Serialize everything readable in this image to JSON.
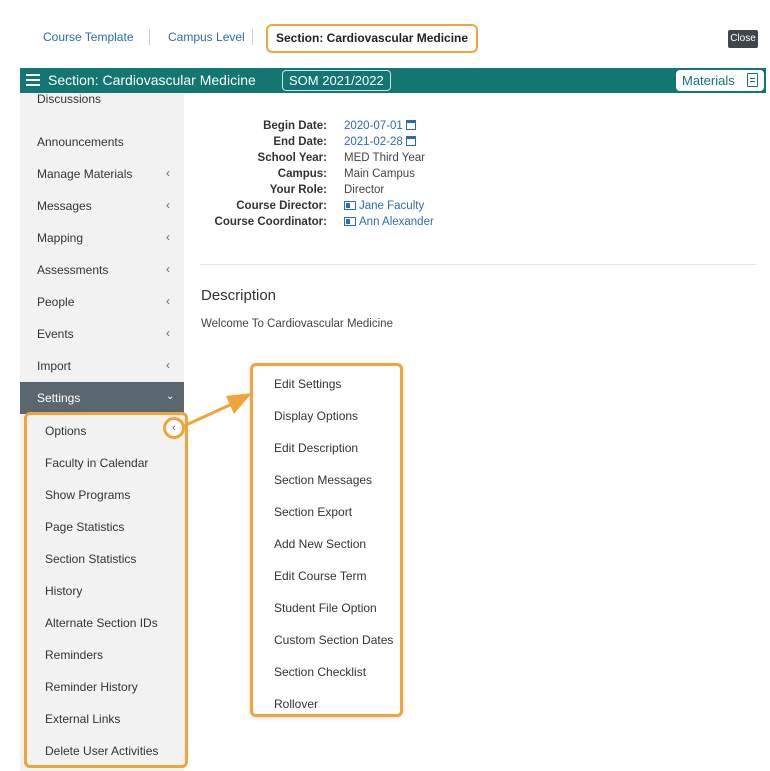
{
  "breadcrumbs": {
    "items": [
      "Course Template",
      "Campus Level"
    ],
    "active": "Section: Cardiovascular Medicine"
  },
  "close_label": "Close",
  "header": {
    "title": "Section: Cardiovascular Medicine",
    "year_badge": "SOM 2021/2022",
    "materials_label": "Materials"
  },
  "sidebar": {
    "items": [
      {
        "label": "Discussions",
        "has_submenu": false
      },
      {
        "label": "Announcements",
        "has_submenu": false
      },
      {
        "label": "Manage Materials",
        "has_submenu": true
      },
      {
        "label": "Messages",
        "has_submenu": true
      },
      {
        "label": "Mapping",
        "has_submenu": true
      },
      {
        "label": "Assessments",
        "has_submenu": true
      },
      {
        "label": "People",
        "has_submenu": true
      },
      {
        "label": "Events",
        "has_submenu": true
      },
      {
        "label": "Import",
        "has_submenu": true
      },
      {
        "label": "Settings",
        "has_submenu": true,
        "expanded": true
      }
    ],
    "settings_subitems": [
      "Options",
      "Faculty in Calendar",
      "Show Programs",
      "Page Statistics",
      "Section Statistics",
      "History",
      "Alternate Section IDs",
      "Reminders",
      "Reminder History",
      "External Links",
      "Delete User Activities"
    ]
  },
  "section_info": {
    "begin_date_label": "Begin Date:",
    "begin_date": "2020-07-01",
    "end_date_label": "End Date:",
    "end_date": "2021-02-28",
    "school_year_label": "School Year:",
    "school_year": "MED Third Year",
    "campus_label": "Campus:",
    "campus": "Main Campus",
    "role_label": "Your Role:",
    "role": "Director",
    "director_label": "Course Director:",
    "director": "Jane Faculty",
    "coordinator_label": "Course Coordinator:",
    "coordinator": "Ann Alexander"
  },
  "description": {
    "heading": "Description",
    "text": "Welcome To Cardiovascular Medicine"
  },
  "options_menu": {
    "items": [
      "Edit Settings",
      "Display Options",
      "Edit Description",
      "Section Messages",
      "Section Export",
      "Add New Section",
      "Edit Course Term",
      "Student File Option",
      "Custom Section Dates",
      "Section Checklist",
      "Rollover"
    ]
  },
  "colors": {
    "header_bg": "#127673",
    "highlight": "#f0a43a",
    "link": "#2a6db4",
    "active_item": "#5a6770"
  }
}
